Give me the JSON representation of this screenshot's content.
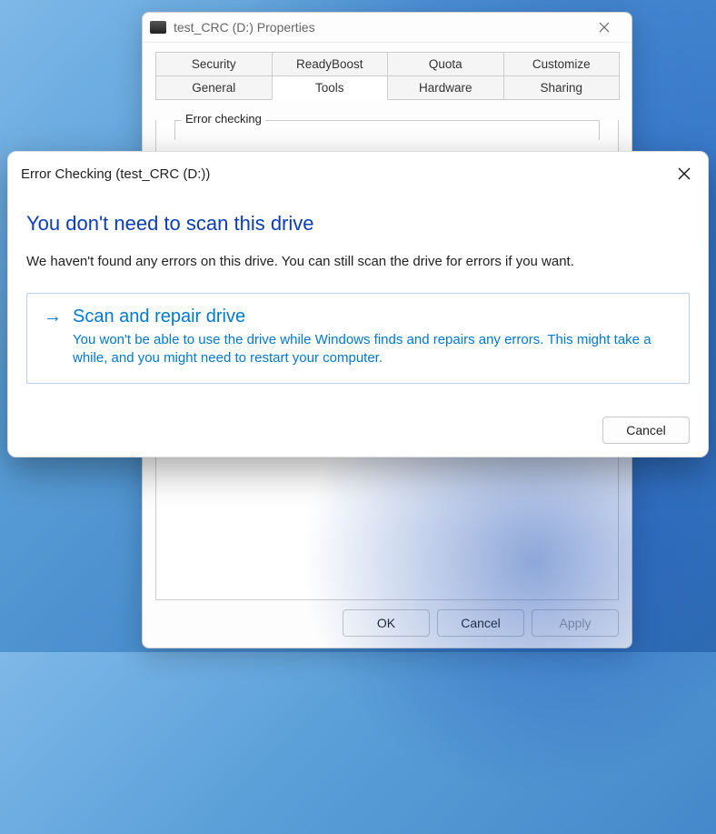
{
  "properties_window": {
    "title": "test_CRC (D:) Properties",
    "tabs_row1": [
      "Security",
      "ReadyBoost",
      "Quota",
      "Customize"
    ],
    "tabs_row2": [
      "General",
      "Tools",
      "Hardware",
      "Sharing"
    ],
    "active_tab": "Tools",
    "groupbox_label": "Error checking",
    "buttons": {
      "ok": "OK",
      "cancel": "Cancel",
      "apply": "Apply"
    }
  },
  "error_checking_dialog": {
    "title": "Error Checking (test_CRC (D:))",
    "heading": "You don't need to scan this drive",
    "message": "We haven't found any errors on this drive. You can still scan the drive for errors if you want.",
    "action": {
      "title": "Scan and repair drive",
      "description": "You won't be able to use the drive while Windows finds and repairs any errors. This might take a while, and you might need to restart your computer."
    },
    "cancel": "Cancel"
  }
}
